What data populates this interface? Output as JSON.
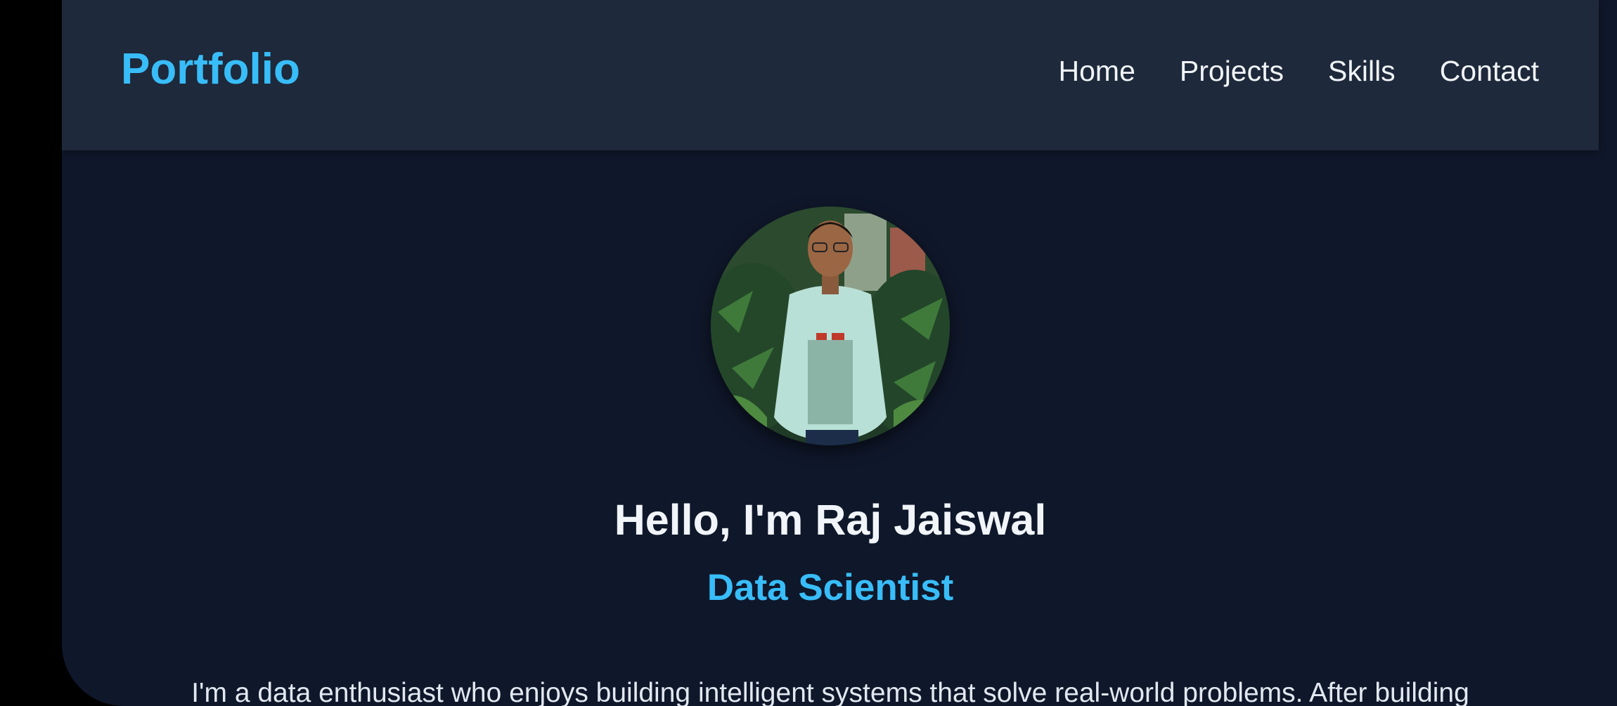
{
  "navbar": {
    "logo": "Portfolio",
    "links": [
      {
        "label": "Home"
      },
      {
        "label": "Projects"
      },
      {
        "label": "Skills"
      },
      {
        "label": "Contact"
      }
    ]
  },
  "hero": {
    "avatar_icon": "profile-photo",
    "greeting": "Hello, I'm Raj Jaiswal",
    "role": "Data Scientist",
    "bio": "I'm a data enthusiast who enjoys building intelligent systems that solve real-world problems. After building"
  },
  "colors": {
    "accent": "#38bdf8",
    "background": "#0f172a",
    "navbar": "#1e293b",
    "text": "#f1f5f9"
  }
}
